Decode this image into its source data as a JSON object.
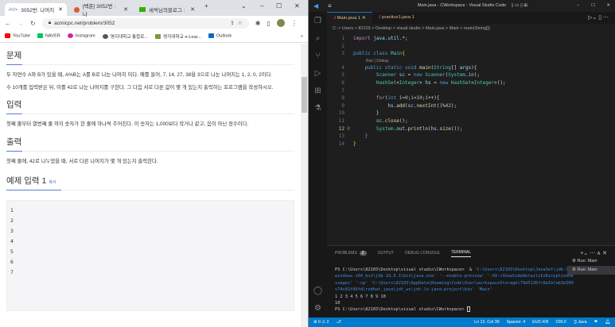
{
  "browser": {
    "tabs": [
      {
        "label": "3052번: 나머지"
      },
      {
        "label": "[백준] 3052번 : 나"
      },
      {
        "label": "세씩님의블로그 : "
      }
    ],
    "url": "acmicpc.net/problem/3052",
    "bookmarks": [
      {
        "label": "YouTube",
        "color": "#ff0000"
      },
      {
        "label": "NAVER",
        "color": "#03c75a"
      },
      {
        "label": "Instagram",
        "color": "#d6249f"
      },
      {
        "label": "명지대학교 통합로...",
        "color": "#555555"
      },
      {
        "label": "명지대학교 e-Lear...",
        "color": "#7a9a3a"
      },
      {
        "label": "Outlook",
        "color": "#0f6cbd"
      }
    ],
    "page": {
      "h_problem": "문제",
      "p1": "두 자연수 A와 B가 있을 때, A%B는 A를 B로 나눈 나머지 이다. 예를 들어, 7, 14, 27, 38을 3으로 나눈 나머지는 1, 2, 0, 2이다.",
      "p2": "수 10개를 입력받은 뒤, 이를 42로 나눈 나머지를 구한다. 그 다음 서로 다른 값이 몇 개 있는지 출력하는 프로그램을 작성하시오.",
      "h_input": "입력",
      "p3": "첫째 줄부터 열번째 줄 까지 숫자가 한 줄에 하나씩 주어진다. 이 숫자는 1,000보다 작거나 같고, 음이 아닌 정수이다.",
      "h_output": "출력",
      "p4": "첫째 줄에, 42로 나누었을 때, 서로 다른 나머지가 몇 개 있는지 출력한다.",
      "h_example": "예제 입력 1",
      "copy": "복사",
      "example": "1\n2\n3\n4\n5\n6\n7"
    }
  },
  "vscode": {
    "title": "Main.java - CWorkspace - Visual Studio Code",
    "tabs": [
      {
        "label": "Main.java 1"
      },
      {
        "label": "practice1.java 1"
      }
    ],
    "breadcrumb": "C: > Users > 82103 > Desktop > visual studio > Main.java > Main > main(String[])",
    "codelens": "Run | Debug",
    "code": [
      [
        [
          "import ",
          "kw"
        ],
        [
          "java.util.*",
          "v"
        ],
        [
          ";",
          "pl"
        ]
      ],
      [],
      [
        [
          "public class ",
          "k"
        ],
        [
          "Main",
          "t"
        ],
        [
          "{",
          "br"
        ]
      ],
      [
        [
          "    public static void ",
          "k"
        ],
        [
          "main",
          "f"
        ],
        [
          "(",
          "pl"
        ],
        [
          "String",
          "t"
        ],
        [
          "[] ",
          "pl"
        ],
        [
          "args",
          "v"
        ],
        [
          "){",
          "pl"
        ]
      ],
      [
        [
          "        Scanner ",
          "t"
        ],
        [
          "sc",
          "v"
        ],
        [
          " = ",
          "pl"
        ],
        [
          "new ",
          "k"
        ],
        [
          "Scanner",
          "t"
        ],
        [
          "(",
          "pl"
        ],
        [
          "System",
          "t"
        ],
        [
          ".",
          "pl"
        ],
        [
          "in",
          "v"
        ],
        [
          ");",
          "pl"
        ]
      ],
      [
        [
          "        HashSet",
          "t"
        ],
        [
          "<",
          "pl"
        ],
        [
          "Integer",
          "t"
        ],
        [
          "> ",
          "pl"
        ],
        [
          "hs",
          "v"
        ],
        [
          " = ",
          "pl"
        ],
        [
          "new ",
          "k"
        ],
        [
          "HashSet",
          "t"
        ],
        [
          "<",
          "pl"
        ],
        [
          "Integer",
          "t"
        ],
        [
          ">();",
          "pl"
        ]
      ],
      [],
      [
        [
          "        for",
          "kw"
        ],
        [
          "(",
          "pl"
        ],
        [
          "int ",
          "k"
        ],
        [
          "i",
          "v"
        ],
        [
          "=",
          "pl"
        ],
        [
          "0",
          "n"
        ],
        [
          ";",
          "pl"
        ],
        [
          "i",
          "v"
        ],
        [
          "<",
          "pl"
        ],
        [
          "10",
          "n"
        ],
        [
          ";",
          "pl"
        ],
        [
          "i",
          "v"
        ],
        [
          "++){",
          "pl"
        ]
      ],
      [
        [
          "            hs",
          "v"
        ],
        [
          ".",
          "pl"
        ],
        [
          "add",
          "f"
        ],
        [
          "(",
          "pl"
        ],
        [
          "sc",
          "v"
        ],
        [
          ".",
          "pl"
        ],
        [
          "nextInt",
          "f"
        ],
        [
          "()%",
          "pl"
        ],
        [
          "42",
          "n"
        ],
        [
          ");",
          "pl"
        ]
      ],
      [
        [
          "        }",
          "pl"
        ]
      ],
      [
        [
          "        sc",
          "v"
        ],
        [
          ".",
          "pl"
        ],
        [
          "close",
          "f"
        ],
        [
          "();",
          "pl"
        ]
      ],
      [
        [
          "        System",
          "t"
        ],
        [
          ".",
          "pl"
        ],
        [
          "out",
          "v"
        ],
        [
          ".",
          "pl"
        ],
        [
          "println",
          "f"
        ],
        [
          "(",
          "pl"
        ],
        [
          "hs",
          "v"
        ],
        [
          ".",
          "pl"
        ],
        [
          "size",
          "f"
        ],
        [
          "());",
          "pl"
        ]
      ],
      [
        [
          "    }",
          "kw"
        ]
      ],
      [
        [
          "}",
          "br"
        ]
      ]
    ],
    "panel": {
      "tabs": [
        "PROBLEMS",
        "OUTPUT",
        "DEBUG CONSOLE",
        "TERMINAL"
      ],
      "problems_count": "2",
      "terminal_prompt": "PS C:\\Users\\82103\\Desktop\\visual studio\\CWorkspace>  & ",
      "terminal_cmd": "'C:\\Users\\82103\\Desktop\\JavaSet\\jdk-19_windows-x64_bin\\jdk-19.0.1\\bin\\java.exe' '--enable-preview' '-XX:+ShowCodeDetailsInExceptionMessages' '-cp' 'C:\\Users\\82103\\AppData\\Roaming\\Code\\User\\workspaceStorage\\79d5136fc0a1bfab3e500c74c81f66fd\\redhat.java\\jdt_ws\\jdt.ls-java-project\\bin' 'Main'",
      "output1": "1 2 3 4 5 6 7 8 9 10",
      "output2": "10",
      "prompt2": "PS C:\\Users\\82103\\Desktop\\visual studio\\CWorkspace> ",
      "runs": [
        "Run: Main",
        "Run: Main"
      ]
    },
    "status": {
      "errors": "⊗ 0 ⚠ 2",
      "position": "Ln 12, Col 39",
      "spaces": "Spaces: 4",
      "encoding": "EUC-KR",
      "eol": "CRLF",
      "language": "{} Java"
    }
  }
}
